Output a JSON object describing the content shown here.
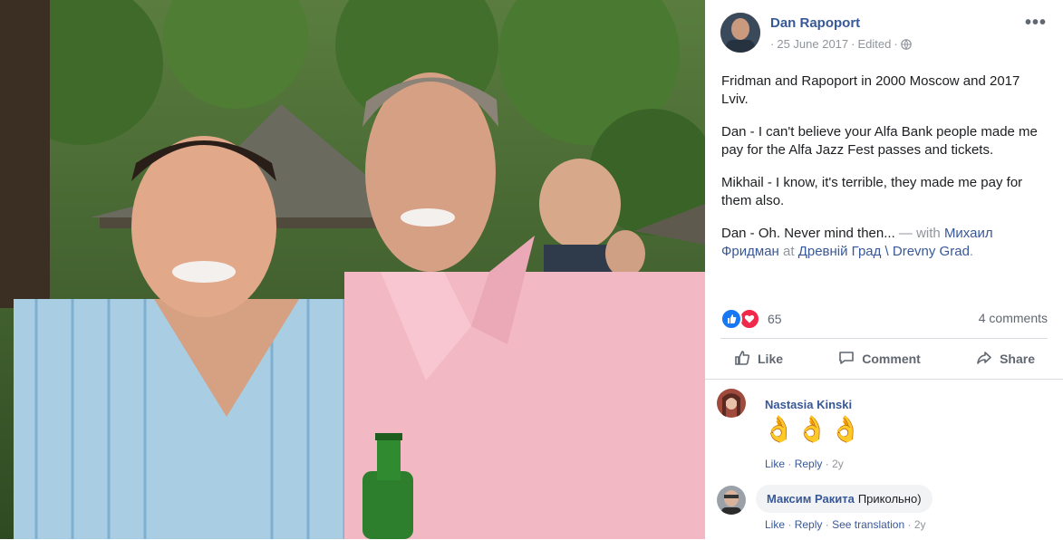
{
  "post": {
    "author": "Dan Rapoport",
    "date": "25 June 2017",
    "edited": "Edited",
    "more_label": "•••",
    "paragraphs": [
      "Fridman and Rapoport in 2000 Moscow and 2017 Lviv.",
      "Dan - I can't believe your Alfa Bank people made me pay for the Alfa Jazz Fest passes and tickets.",
      "Mikhail - I know, it's terrible, they made me pay for them also."
    ],
    "last_paragraph": {
      "text": "Dan - Oh. Never mind then...",
      "with_label": " — with ",
      "tagged": "Михаил Фридман",
      "at_label": " at ",
      "place": "Древній Град \\ Drevny Grad",
      "end": "."
    }
  },
  "reactions": {
    "count": "65",
    "comments_label": "4 comments"
  },
  "actions": {
    "like": "Like",
    "comment": "Comment",
    "share": "Share"
  },
  "comments": [
    {
      "name": "Nastasia Kinski",
      "emoji": [
        "👌",
        "👌",
        "👌"
      ],
      "like": "Like",
      "reply": "Reply",
      "age": "2y"
    },
    {
      "name": "Максим Ракита",
      "text": "Прикольно)",
      "like": "Like",
      "reply": "Reply",
      "translate": "See translation",
      "age": "2y"
    }
  ],
  "colors": {
    "link": "#385898",
    "meta": "#90949c",
    "like_blue": "#1877f2",
    "love_red": "#f0284a"
  },
  "icons": [
    "globe-icon",
    "like-icon",
    "comment-icon",
    "share-icon",
    "like-reaction-icon",
    "love-reaction-icon",
    "more-icon"
  ]
}
